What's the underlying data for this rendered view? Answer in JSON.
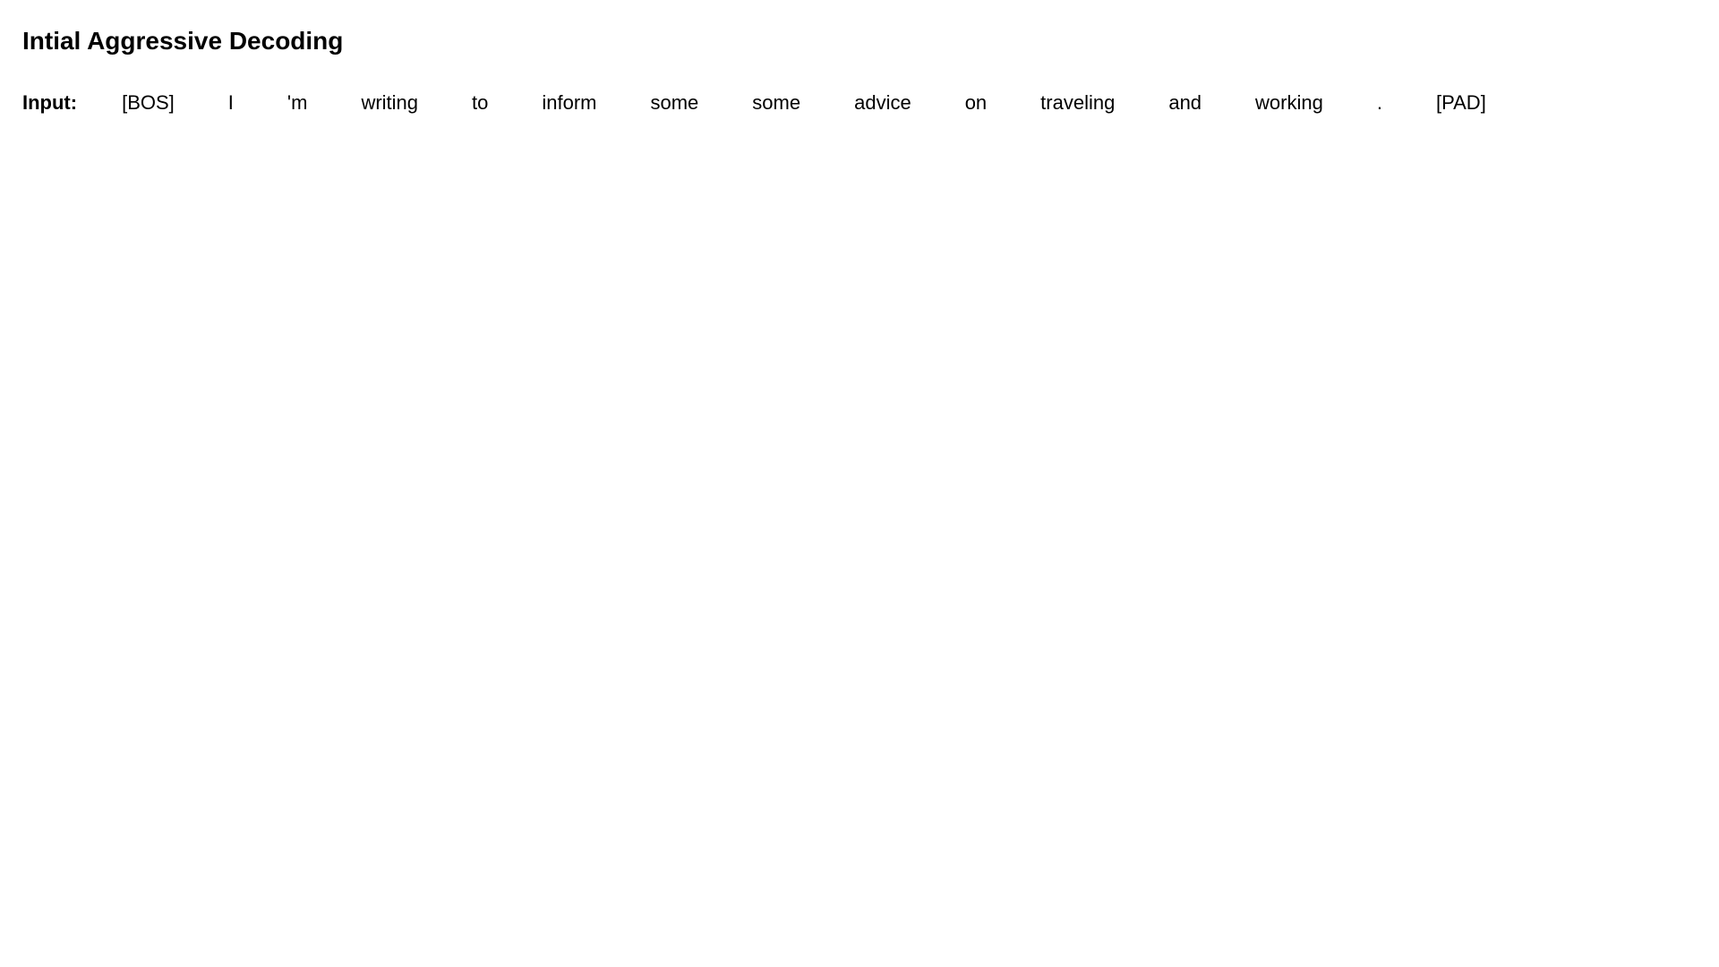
{
  "page": {
    "title": "Intial Aggressive Decoding"
  },
  "input": {
    "label": "Input:",
    "tokens": [
      "[BOS]",
      "I",
      "'m",
      "writing",
      "to",
      "inform",
      "some",
      "some",
      "advice",
      "on",
      "traveling",
      "and",
      "working",
      ".",
      "[PAD]"
    ]
  }
}
